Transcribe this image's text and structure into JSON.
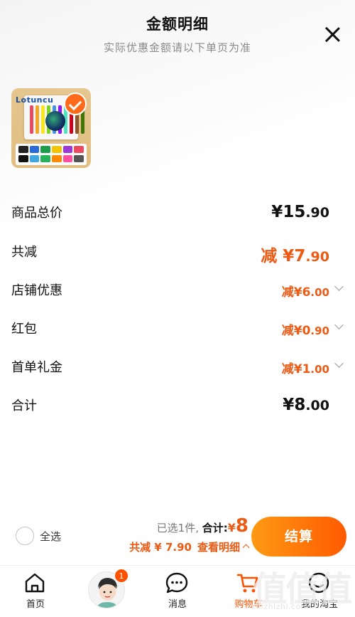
{
  "header": {
    "title": "金额明细",
    "subtitle": "实际优惠金额请以下单页为准",
    "close_icon": "close-icon"
  },
  "product": {
    "thumb_text": "Lotuncu",
    "selected": true
  },
  "rows": {
    "total": {
      "label": "商品总价",
      "symbol": "¥",
      "int": "15",
      "cents": ".90"
    },
    "discount": {
      "label": "共减",
      "prefix": "减",
      "symbol": "¥",
      "int": "7",
      "cents": ".90"
    },
    "shop": {
      "label": "店铺优惠",
      "prefix": "减",
      "symbol": "¥",
      "int": "6",
      "cents": ".00"
    },
    "redpack": {
      "label": "红包",
      "prefix": "减",
      "symbol": "¥",
      "int": "0",
      "cents": ".90"
    },
    "firstorder": {
      "label": "首单礼金",
      "prefix": "减",
      "symbol": "¥",
      "int": "1",
      "cents": ".00"
    },
    "sum": {
      "label": "合计",
      "symbol": "¥",
      "int": "8",
      "cents": ".00"
    }
  },
  "checkout": {
    "select_all": "全选",
    "selected_count": "已选1件,",
    "total_label": "合计:",
    "total_symbol": "¥",
    "total_value": "8",
    "discount_text": "共减 ¥ 7.90",
    "detail_link": "查看明细",
    "button": "结算"
  },
  "tabs": [
    {
      "label": "首页",
      "icon": "home-icon"
    },
    {
      "label": "",
      "icon": "avatar",
      "badge": "1"
    },
    {
      "label": "消息",
      "icon": "message-icon"
    },
    {
      "label": "购物车",
      "icon": "cart-icon"
    },
    {
      "label": "我的淘宝",
      "icon": "profile-icon"
    }
  ],
  "watermark": {
    "text": "值值值",
    "url": "zhizhizhi.com"
  },
  "colors": {
    "accent": "#ff5000",
    "price_orange": "#ec5a14",
    "thumb_bg": "#e1be82"
  }
}
